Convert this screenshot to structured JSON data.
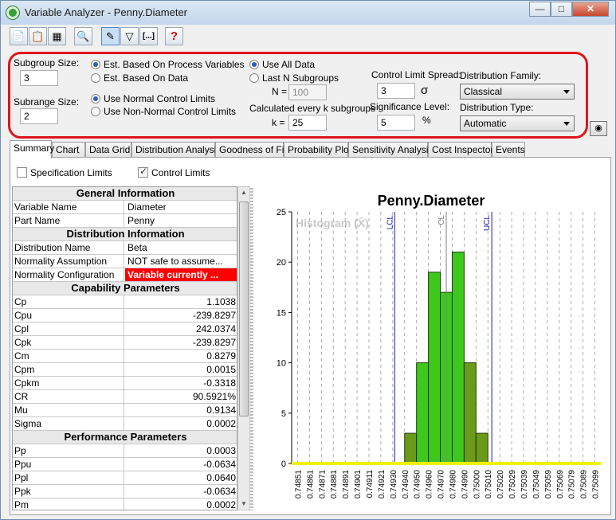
{
  "window": {
    "title": "Variable Analyzer - Penny.Diameter"
  },
  "toolbar": {
    "icons": [
      "copy-icon",
      "copy-data-icon",
      "copy-chart-icon",
      "preview-icon",
      "edit-icon",
      "filter-icon",
      "ellipsis-icon",
      "help-icon"
    ],
    "ellipsis": "[...]",
    "help": "?"
  },
  "settings": {
    "subgroup_size_label": "Subgroup Size:",
    "subgroup_size": "3",
    "subrange_size_label": "Subrange Size:",
    "subrange_size": "2",
    "est_process_label": "Est. Based On Process Variables",
    "est_data_label": "Est. Based On Data",
    "normal_limits_label": "Use Normal Control Limits",
    "nonnormal_limits_label": "Use Non-Normal Control Limits",
    "all_data_label": "Use All Data",
    "last_n_label": "Last N Subgroups",
    "n_label": "N =",
    "n_value": "100",
    "calc_every_label": "Calculated every k subgroups",
    "k_label": "k =",
    "k_value": "25",
    "spread_label": "Control Limit Spread:",
    "spread_value": "3",
    "sigma_symbol": "σ",
    "significance_label": "Significance Level:",
    "significance_value": "5",
    "percent_symbol": "%",
    "family_label": "Distribution Family:",
    "family_value": "Classical",
    "type_label": "Distribution Type:",
    "type_value": "Automatic"
  },
  "tabs": [
    "Summary",
    "Chart",
    "Data Grid",
    "Distribution Analysis",
    "Goodness of Fit",
    "Probability Plot",
    "Sensitivity Analysis",
    "Cost Inspector",
    "Events"
  ],
  "active_tab": "Summary",
  "options": {
    "spec_limits_label": "Specification Limits",
    "control_limits_label": "Control Limits",
    "spec_limits_checked": false,
    "control_limits_checked": true
  },
  "table": [
    {
      "section": "General Information"
    },
    {
      "label": "Variable Name",
      "value": "Diameter"
    },
    {
      "label": "Part Name",
      "value": "Penny"
    },
    {
      "section": "Distribution Information"
    },
    {
      "label": "Distribution Name",
      "value": "Beta"
    },
    {
      "label": "Normality Assumption",
      "value": "NOT safe to assume..."
    },
    {
      "label": "Normality Configuration",
      "value": "Variable currently ...",
      "alert": true
    },
    {
      "section": "Capability Parameters"
    },
    {
      "label": "Cp",
      "value": "1.1038",
      "num": true
    },
    {
      "label": "Cpu",
      "value": "-239.8297",
      "num": true
    },
    {
      "label": "Cpl",
      "value": "242.0374",
      "num": true
    },
    {
      "label": "Cpk",
      "value": "-239.8297",
      "num": true
    },
    {
      "label": "Cm",
      "value": "0.8279",
      "num": true
    },
    {
      "label": "Cpm",
      "value": "0.0015",
      "num": true
    },
    {
      "label": "Cpkm",
      "value": "-0.3318",
      "num": true
    },
    {
      "label": "CR",
      "value": "90.5921%",
      "num": true
    },
    {
      "label": "Mu",
      "value": "0.9134",
      "num": true
    },
    {
      "label": "Sigma",
      "value": "0.0002",
      "num": true
    },
    {
      "section": "Performance Parameters"
    },
    {
      "label": "Pp",
      "value": "0.0003",
      "num": true
    },
    {
      "label": "Ppu",
      "value": "-0.0634",
      "num": true
    },
    {
      "label": "Ppl",
      "value": "0.0640",
      "num": true
    },
    {
      "label": "Ppk",
      "value": "-0.0634",
      "num": true
    },
    {
      "label": "Pm",
      "value": "0.0002",
      "num": true
    }
  ],
  "chart_data": {
    "type": "bar",
    "title": "Penny.Diameter",
    "watermark": "Histogram (X̄)",
    "categories": [
      "0.74851",
      "0.74861",
      "0.74871",
      "0.74881",
      "0.74891",
      "0.74901",
      "0.74911",
      "0.74921",
      "0.74930",
      "0.74940",
      "0.74950",
      "0.74960",
      "0.74970",
      "0.74980",
      "0.74990",
      "0.75000",
      "0.75010",
      "0.75020",
      "0.75029",
      "0.75039",
      "0.75049",
      "0.75059",
      "0.75069",
      "0.75079",
      "0.75089",
      "0.75099"
    ],
    "bins": [
      {
        "x": "0.74940",
        "value": 3,
        "color": "#6b9a1a"
      },
      {
        "x": "0.74950",
        "value": 10,
        "color": "#3ec81c"
      },
      {
        "x": "0.74960",
        "value": 19,
        "color": "#3ec81c"
      },
      {
        "x": "0.74970",
        "value": 17,
        "color": "#3ec81c"
      },
      {
        "x": "0.74980",
        "value": 21,
        "color": "#3ec81c"
      },
      {
        "x": "0.74990",
        "value": 10,
        "color": "#6b9a1a"
      },
      {
        "x": "0.75000",
        "value": 3,
        "color": "#6b9a1a"
      }
    ],
    "ylim": [
      0,
      25
    ],
    "yticks": [
      "0",
      "5",
      "10",
      "15",
      "20",
      "25"
    ],
    "limits": [
      {
        "name": "LCL",
        "x": 0.74932,
        "color": "#1a1ab4"
      },
      {
        "name": "CL",
        "x": 0.74975,
        "color": "#808080"
      },
      {
        "name": "UCL",
        "x": 0.75013,
        "color": "#1a1ab4"
      }
    ],
    "baseline_color": "#f0f000",
    "grid": true
  }
}
